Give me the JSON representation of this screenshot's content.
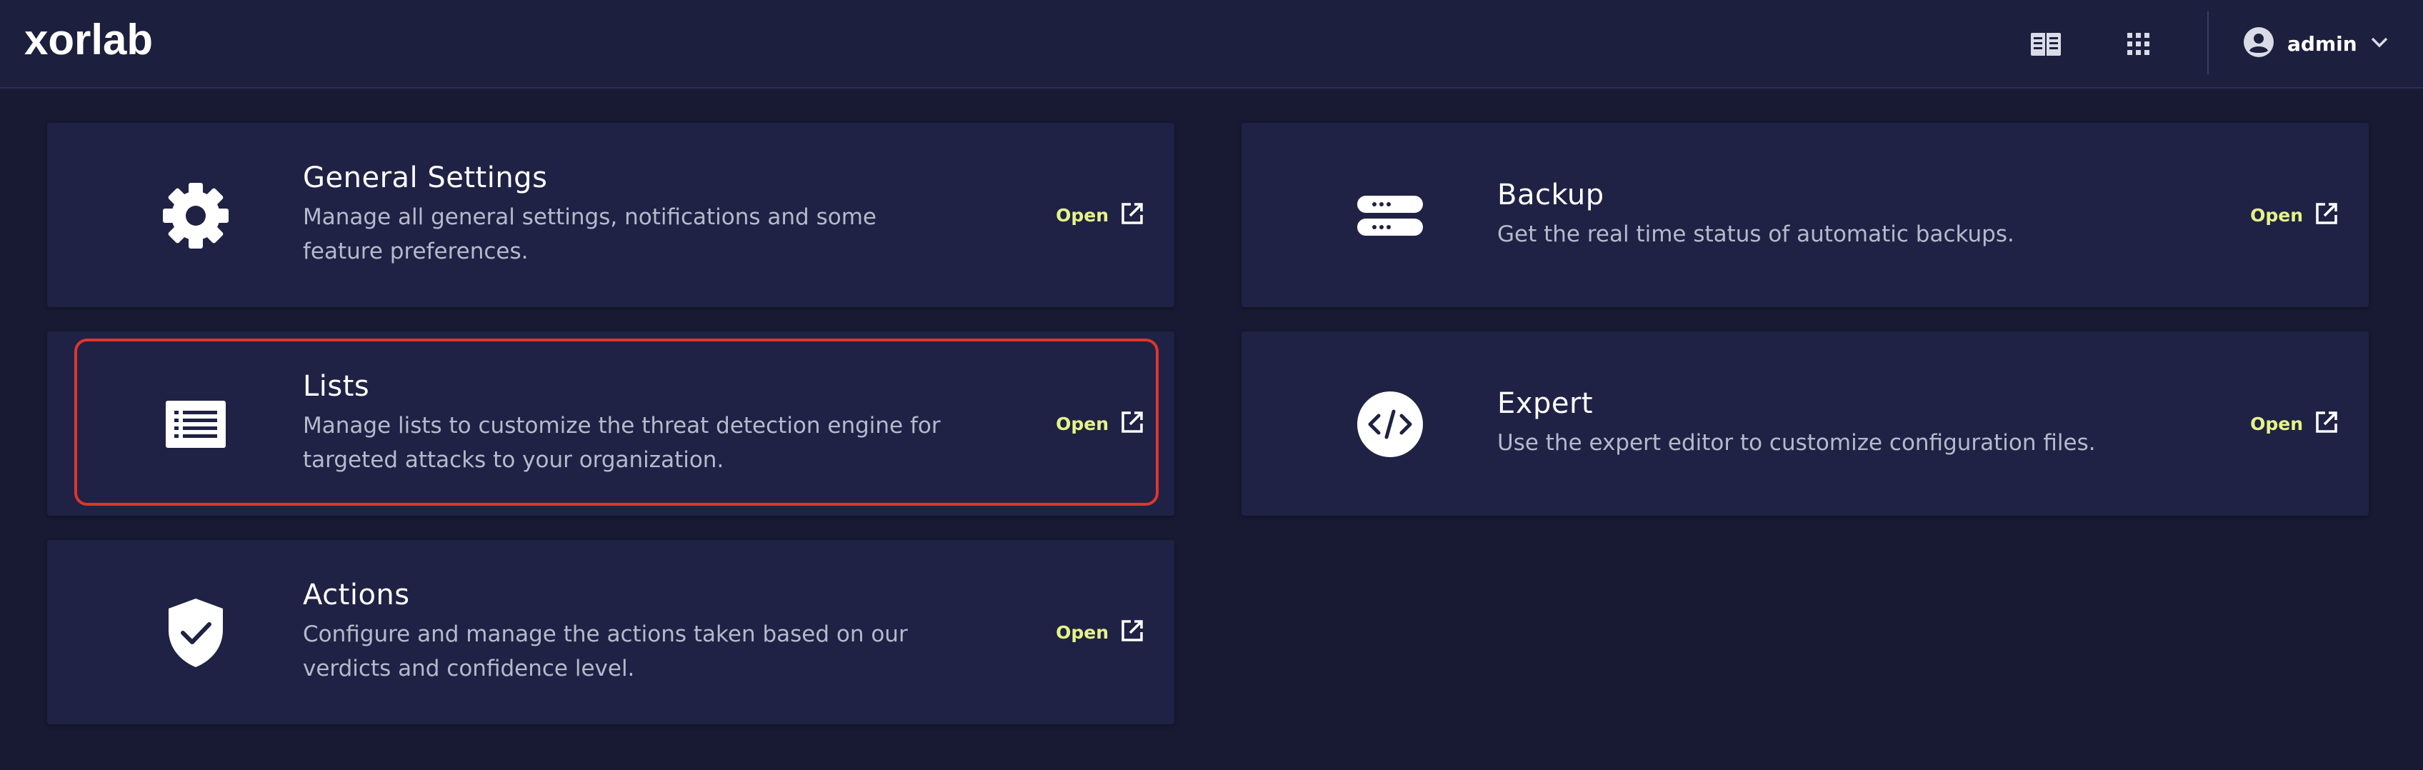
{
  "header": {
    "logo_text": "xorlab",
    "user": {
      "name": "admin"
    }
  },
  "icons": {
    "docs": "book-icon",
    "apps": "apps-grid-icon",
    "user": "account-circle-icon",
    "chevron": "chevron-down-icon",
    "open": "external-link-icon"
  },
  "colors": {
    "background": "#181a33",
    "card": "#1f2244",
    "accent": "#e6f38a",
    "highlight": "#e0352b"
  },
  "cards": {
    "general": {
      "title": "General Settings",
      "description": "Manage all general settings, notifications and some feature preferences.",
      "open_label": "Open",
      "icon": "gear-icon"
    },
    "backup": {
      "title": "Backup",
      "description": "Get the real time status of automatic backups.",
      "open_label": "Open",
      "icon": "server-icon"
    },
    "lists": {
      "title": "Lists",
      "description": "Manage lists to customize the threat detection engine for targeted attacks to your organization.",
      "open_label": "Open",
      "icon": "list-icon"
    },
    "expert": {
      "title": "Expert",
      "description": "Use the expert editor to customize configuration files.",
      "open_label": "Open",
      "icon": "code-icon"
    },
    "actions": {
      "title": "Actions",
      "description": "Configure and manage the actions taken based on our verdicts and confidence level.",
      "open_label": "Open",
      "icon": "shield-check-icon"
    }
  }
}
